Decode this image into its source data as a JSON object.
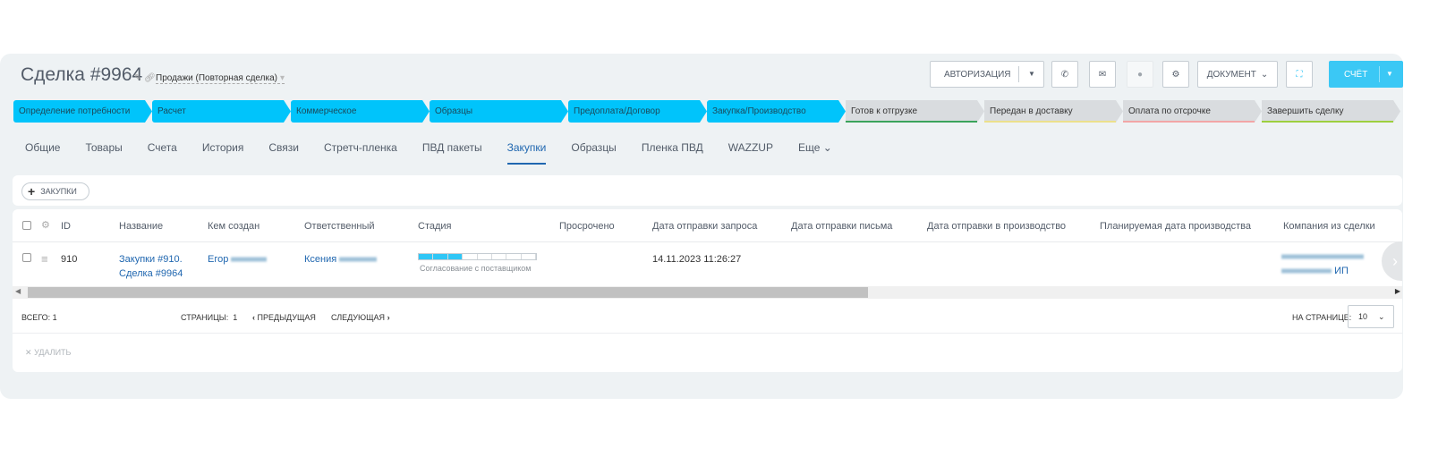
{
  "header": {
    "title": "Сделка #9964",
    "category": "Продажи (Повторная сделка)"
  },
  "toolbar": {
    "auth": "АВТОРИЗАЦИЯ",
    "document": "ДОКУМЕНТ",
    "invoice": "СЧЁТ"
  },
  "stages": [
    {
      "label": "Определение потребности",
      "state": "active"
    },
    {
      "label": "Расчет",
      "state": "active"
    },
    {
      "label": "Коммерческое",
      "state": "active"
    },
    {
      "label": "Образцы",
      "state": "active"
    },
    {
      "label": "Предоплата/Договор",
      "state": "active"
    },
    {
      "label": "Закупка/Производство",
      "state": "active"
    },
    {
      "label": "Готов к отгрузке",
      "state": "inactive",
      "color": "#3aa35b"
    },
    {
      "label": "Передан в доставку",
      "state": "inactive",
      "color": "#ece08c"
    },
    {
      "label": "Оплата по отсрочке",
      "state": "inactive",
      "color": "#f2a6a6"
    },
    {
      "label": "Завершить сделку",
      "state": "inactive",
      "color": "#9dcf3e"
    }
  ],
  "colors": {
    "accent": "#00c4fb",
    "link": "#2067b0"
  },
  "tabs": [
    "Общие",
    "Товары",
    "Счета",
    "История",
    "Связи",
    "Стретч-пленка",
    "ПВД пакеты",
    "Закупки",
    "Образцы",
    "Пленка ПВД",
    "WAZZUP",
    "Еще"
  ],
  "active_tab": "Закупки",
  "add_button": "ЗАКУПКИ",
  "table": {
    "columns": [
      "ID",
      "Название",
      "Кем создан",
      "Ответственный",
      "Стадия",
      "Просрочено",
      "Дата отправки запроса",
      "Дата отправки письма",
      "Дата отправки в производство",
      "Планируемая дата производства",
      "Компания из сделки"
    ],
    "rows": [
      {
        "id": "910",
        "name_line1": "Закупки #910.",
        "name_line2": "Сделка #9964",
        "created_by": "Егор",
        "responsible": "Ксения",
        "stage": "Согласование с поставщиком",
        "stage_progress_segments": 3,
        "stage_total_segments": 8,
        "sent_request": "14.11.2023 11:26:27",
        "company_suffix": "ИП"
      }
    ]
  },
  "scroll_fraction": 0.61,
  "footer": {
    "total": "ВСЕГО: 1",
    "pages": "СТРАНИЦЫ:  1",
    "prev": "ПРЕДЫДУЩАЯ",
    "next": "СЛЕДУЮЩАЯ",
    "per_page_label": "НА СТРАНИЦЕ:",
    "per_page": "10",
    "delete": "УДАЛИТЬ"
  }
}
